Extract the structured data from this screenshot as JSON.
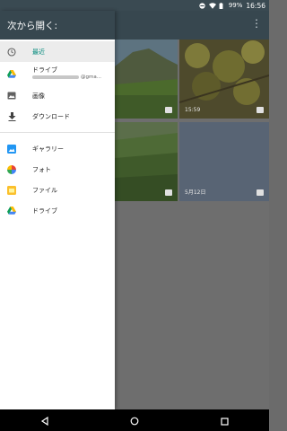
{
  "status": {
    "battery": "99%",
    "time": "16:56"
  },
  "drawer": {
    "title": "次から開く:",
    "items": [
      {
        "label": "最近",
        "icon": "clock-icon",
        "active": true
      },
      {
        "label": "ドライブ",
        "sub": "@gma...",
        "icon": "drive-icon"
      },
      {
        "label": "画像",
        "icon": "image-icon"
      },
      {
        "label": "ダウンロード",
        "icon": "download-icon"
      }
    ],
    "apps": [
      {
        "label": "ギャラリー",
        "icon": "gallery-icon"
      },
      {
        "label": "フォト",
        "icon": "photos-icon"
      },
      {
        "label": "ファイル",
        "icon": "files-icon"
      },
      {
        "label": "ドライブ",
        "icon": "drive-icon"
      }
    ]
  },
  "grid": {
    "tiles": [
      {
        "caption": ""
      },
      {
        "caption": "15:59"
      },
      {
        "caption": ""
      },
      {
        "caption": "5月12日"
      }
    ]
  },
  "appbar": {
    "overflow_icon": "more-vert-icon"
  },
  "colors": {
    "appbar": "#37474f",
    "accent": "#00897b",
    "drawer": "#ffffff"
  }
}
